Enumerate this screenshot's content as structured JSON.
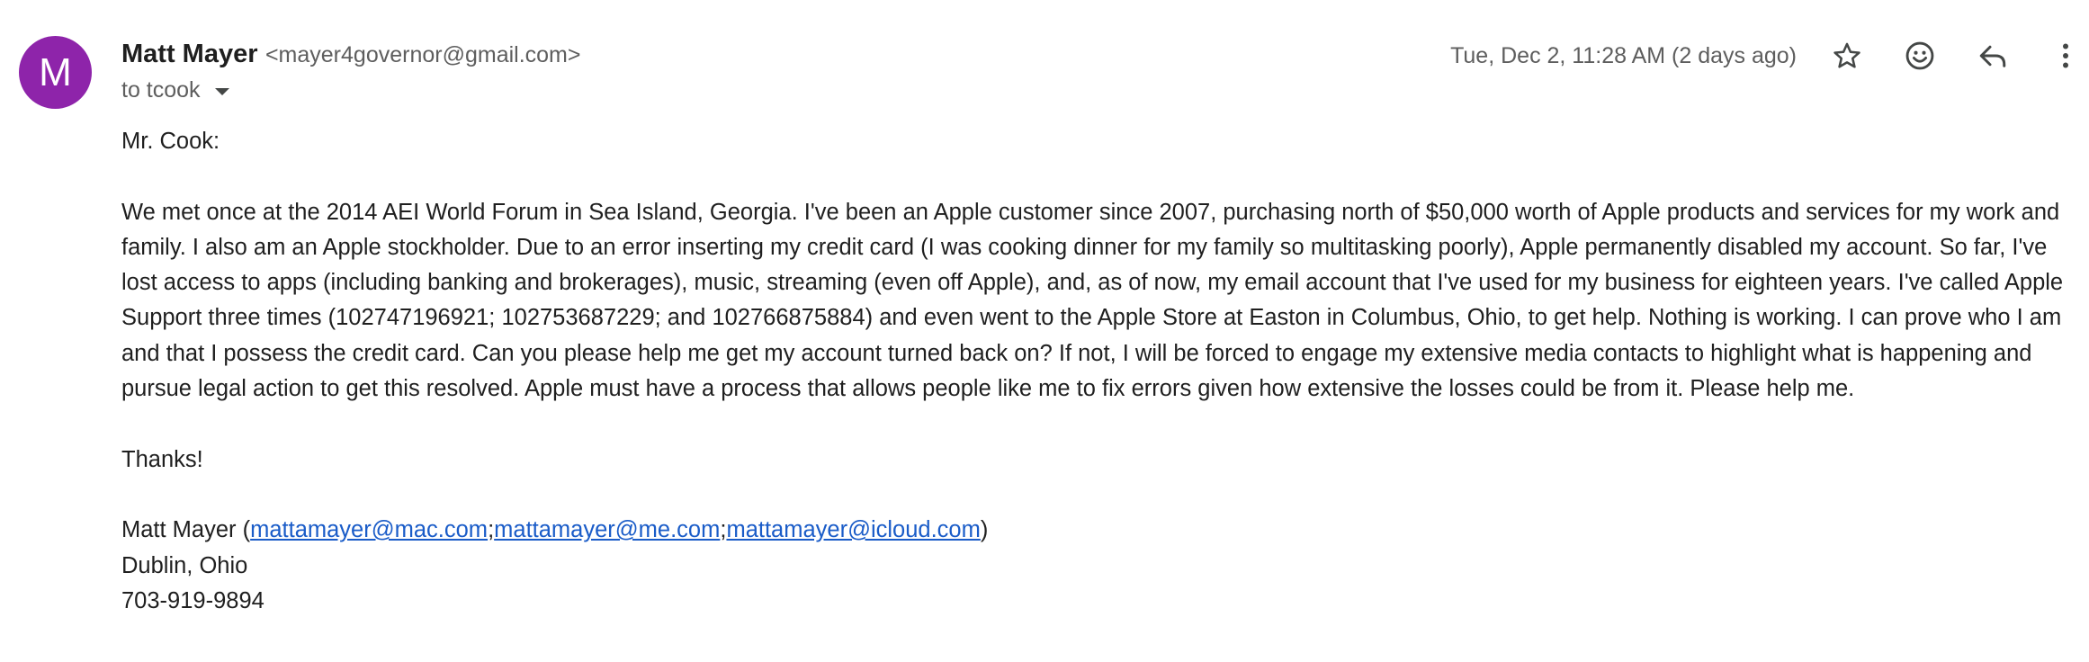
{
  "avatar": {
    "initial": "M",
    "color": "#8e24aa"
  },
  "sender": {
    "name": "Matt Mayer",
    "email": "<mayer4governor@gmail.com>"
  },
  "recipient_line": "to tcook",
  "timestamp": "Tue, Dec 2, 11:28 AM (2 days ago)",
  "actions": [
    "star-icon",
    "emoji-reaction-icon",
    "reply-icon",
    "more-vert-icon"
  ],
  "body": {
    "greeting": "Mr. Cook:",
    "paragraph": "We met once at the 2014 AEI World Forum in Sea Island, Georgia. I've been an Apple customer since 2007, purchasing north of $50,000 worth of Apple products and services for my work and family. I also am an Apple stockholder. Due to an error inserting my credit card (I was cooking dinner for my family so multitasking poorly), Apple permanently disabled my account. So far, I've lost access to apps (including banking and brokerages), music, streaming (even off Apple), and, as of now, my email account that I've used for my business for eighteen years. I've called Apple Support three times (102747196921; 102753687229; and 102766875884) and even went to the Apple Store at Easton in Columbus, Ohio, to get help. Nothing is working. I can prove who I am and that I possess the credit card. Can you please help me get my account turned back on? If not, I will be forced to engage my extensive media contacts to highlight what is happening and pursue legal action to get this resolved. Apple must have a process that allows people like me to fix errors given how extensive the losses could be from it. Please help me.",
    "closing": "Thanks!",
    "signature": {
      "name_prefix": "Matt Mayer (",
      "links": [
        "mattamayer@mac.com",
        "mattamayer@me.com",
        "mattamayer@icloud.com"
      ],
      "separator": ";",
      "suffix": ")",
      "location": "Dublin, Ohio",
      "phone": "703-919-9894"
    }
  },
  "colors": {
    "link": "#1a5cc8",
    "secondary_text": "#5e5e5e",
    "primary_text": "#1f1f1f"
  }
}
